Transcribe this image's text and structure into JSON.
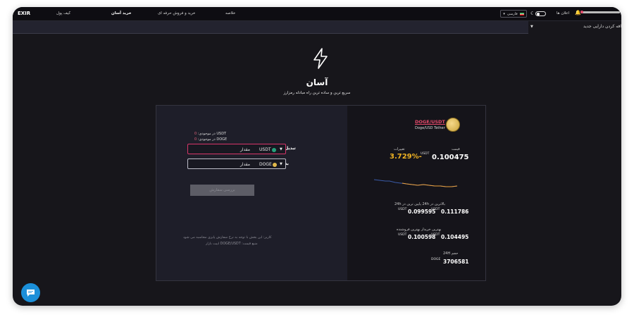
{
  "header": {
    "logo": "EXIR",
    "nav": [
      "کیف پول",
      "خرید آسان",
      "خرید و فروش حرفه ای",
      "خلاصه"
    ],
    "active_nav": "خرید آسان",
    "language": "فارسی",
    "notifications": "اعلان ها"
  },
  "subbar": {
    "asset_add": "افه کردن دارایی جدید"
  },
  "hero": {
    "title": "آسان",
    "subtitle": "سریع ترین و ساده ترین راه مبادله رمزارز"
  },
  "converter": {
    "balance_usdt": "USDT در موجودی:",
    "balance_usdt_value": "0",
    "balance_doge": "DOGE در موجودی:",
    "balance_doge_value": "0",
    "from_label": "تبدیل",
    "to_label": "به",
    "from_coin": "USDT",
    "to_coin": "DOGE",
    "amount_placeholder": "مقدار",
    "review_button": "بررسی سفارش",
    "note_line1": "کاربر: این بخش با توجه به نرخ سفارش پایزی محاسبه می شود",
    "note_line2": "منبع قیمت: DOGE/USDT ابیت بازار"
  },
  "market": {
    "pair": "DOGE/USDT",
    "pair_sub": "Doge/USD Tether",
    "price_label": "قیمت",
    "change_label": "تغییرات",
    "price": "0.100475",
    "price_unit": "USDT",
    "change": "3.729%-",
    "high_low_label": "بالاترین در 24h   پایین ترین در 24h",
    "high_24h": "0.111786",
    "low_24h": "0.099595",
    "bid_ask_label": "بهترین خریدار   بهترین فروشنده",
    "best_buyer": "0.100598",
    "best_seller": "0.104495",
    "volume_label": "حجم 24H",
    "volume": "3706581",
    "volume_unit": "DOGE",
    "unit": "USDT"
  },
  "colors": {
    "accent": "#e24a6a",
    "change": "#f0b323",
    "background": "#17161b"
  }
}
